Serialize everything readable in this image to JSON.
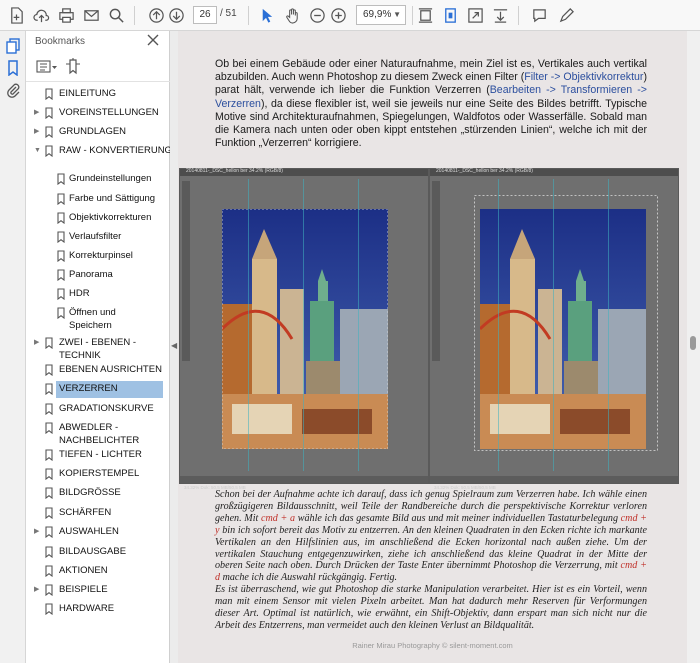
{
  "toolbar": {
    "page_current": "26",
    "page_total": "/ 51",
    "zoom": "69,9%"
  },
  "panel": {
    "title": "Bookmarks"
  },
  "bookmarks": [
    {
      "label": "EINLEITUNG",
      "arrow": ""
    },
    {
      "label": "VOREINSTELLUNGEN",
      "arrow": "▶"
    },
    {
      "label": "GRUNDLAGEN",
      "arrow": "▶"
    },
    {
      "label": "RAW - KONVERTIERUNG",
      "arrow": "▼"
    },
    {
      "label": "Grundeinstellungen",
      "arrow": ""
    },
    {
      "label": "Farbe und Sättigung",
      "arrow": ""
    },
    {
      "label": "Objektivkorrekturen",
      "arrow": ""
    },
    {
      "label": "Verlaufsfilter",
      "arrow": ""
    },
    {
      "label": "Korrekturpinsel",
      "arrow": ""
    },
    {
      "label": "Panorama",
      "arrow": ""
    },
    {
      "label": "HDR",
      "arrow": ""
    },
    {
      "label": "Öffnen und",
      "label2": "Speichern",
      "arrow": ""
    },
    {
      "label": "ZWEI - EBENEN -",
      "label2": "TECHNIK",
      "arrow": "▶"
    },
    {
      "label": "EBENEN AUSRICHTEN",
      "arrow": ""
    },
    {
      "label": "VERZERREN",
      "arrow": ""
    },
    {
      "label": "GRADATIONSKURVE",
      "arrow": ""
    },
    {
      "label": "ABWEDLER -",
      "label2": "NACHBELICHTER",
      "arrow": ""
    },
    {
      "label": "TIEFEN - LICHTER",
      "arrow": ""
    },
    {
      "label": "KOPIERSTEMPEL",
      "arrow": ""
    },
    {
      "label": "BILDGRÖSSE",
      "arrow": ""
    },
    {
      "label": "SCHÄRFEN",
      "arrow": ""
    },
    {
      "label": "AUSWAHLEN",
      "arrow": "▶"
    },
    {
      "label": "BILDAUSGABE",
      "arrow": ""
    },
    {
      "label": "AKTIONEN",
      "arrow": ""
    },
    {
      "label": "BEISPIELE",
      "arrow": "▶"
    },
    {
      "label": "HARDWARE",
      "arrow": ""
    }
  ],
  "document": {
    "para1_a": "Ob bei einem Gebäude oder einer Naturaufnahme, mein Ziel ist es, Vertikales auch vertikal abzubilden. Auch wenn Photoshop zu diesem Zweck einen Filter (",
    "para1_link1": "Filter -> Objektivkorrektur",
    "para1_b": ") parat hält, verwende ich lieber die Funktion Verzerren (",
    "para1_link2": "Bearbeiten -> Transformieren -> Verzerren",
    "para1_c": "), da diese flexibler ist, weil sie jeweils nur eine Seite des Bildes betrifft. Typische Motive sind Architekturaufnahmen, Spiegelungen, Waldfotos oder Wasserfälle. Sobald man die Kamera nach unten oder oben kippt entstehen „stürzenden Linien“, welche ich mit der Funktion „Verzerren“ korrigiere.",
    "shot_left_title": "20140811-_DSC_hellon ber 34.2% (RGB/8)",
    "shot_right_title": "20140811-_DSC_hellon ber 34.2% (RGB/8)",
    "shot_status": "34.32%   Dok: 50,5 MB/50,5 MB",
    "cap_a": "Schon bei der Aufnahme achte ich darauf, dass ich genug Spielraum zum Verzerren habe. Ich wähle einen großzügigeren Bildausschnitt, weil Teile der Randbereiche durch die perspektivische Korrektur verloren gehen. Mit ",
    "cap_k1": "cmd + a",
    "cap_b": " wähle ich das gesamte Bild aus und mit meiner individuellen Tastaturbelegung ",
    "cap_k2": "cmd + y",
    "cap_c": " bin ich sofort bereit das Motiv zu entzerren. An den kleinen Quadraten in den Ecken richte ich markante Vertikalen an den Hilfslinien aus, im anschließend die Ecken horizontal nach außen ziehe. Um der vertikalen Stauchung entgegenzuwirken, ziehe ich anschließend das kleine Quadrat in der Mitte der oberen Seite nach oben. Durch Drücken der Taste Enter übernimmt Photoshop die Verzerrung, mit ",
    "cap_k3": "cmd + d",
    "cap_d": " mache ich die Auswahl rückgängig. Fertig.",
    "cap_e": "Es ist überraschend, wie gut Photoshop die starke Manipulation verarbeitet. Hier ist es ein Vorteil, wenn man mit einem Sensor mit vielen Pixeln arbeitet. Man hat dadurch mehr Reserven für Verformungen dieser Art. Optimal ist natürlich, wie erwähnt, ein Shift-Objektiv, dann erspart man sich nicht nur die Arbeit des Entzerrens, man vermeidet auch den kleinen Verlust an Bildqualität.",
    "footer": "Rainer Mirau Photography © silent-moment.com"
  },
  "colors": {
    "accent": "#2a6fd6",
    "selection": "#9fc1e3",
    "link": "#2c4f9e",
    "shortcut": "#c0322b"
  }
}
